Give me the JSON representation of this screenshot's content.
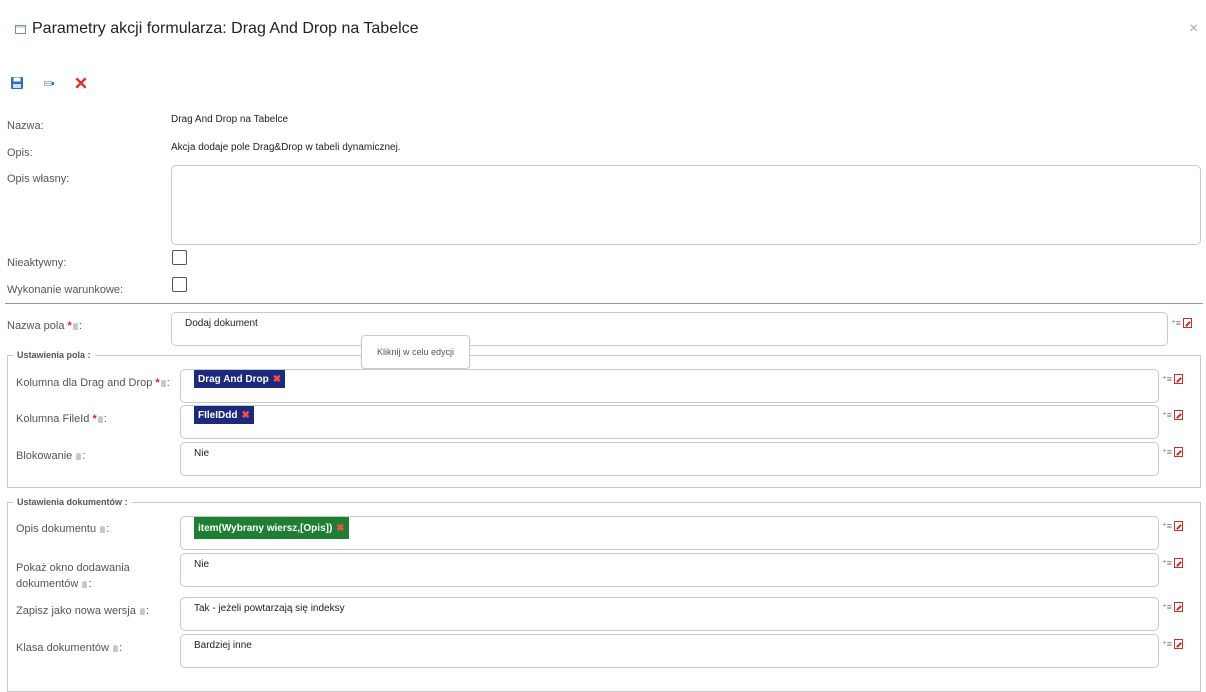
{
  "window": {
    "title": "Parametry akcji formularza: Drag And Drop na Tabelce",
    "close_glyph": "×"
  },
  "toolbar": {
    "save_icon": "save-icon",
    "export_icon": "export-icon",
    "delete_icon": "delete-icon"
  },
  "general": {
    "name_label": "Nazwa:",
    "name_value": "Drag And Drop na Tabelce",
    "desc_label": "Opis:",
    "desc_value": "Akcja dodaje pole Drag&Drop w tabeli dynamicznej.",
    "own_desc_label": "Opis własny:",
    "own_desc_value": "",
    "inactive_label": "Nieaktywny:",
    "conditional_label": "Wykonanie warunkowe:"
  },
  "field_name": {
    "label": "Nazwa pola",
    "value": "Dodaj dokument",
    "tooltip": "Kliknij w celu edycji"
  },
  "field_settings": {
    "legend": "Ustawienia pola :",
    "drag_col_label": "Kolumna dla Drag and Drop",
    "drag_col_tag": "Drag And Drop",
    "fileid_label": "Kolumna FileId",
    "fileid_tag": "FIleIDdd",
    "blocking_label": "Blokowanie",
    "blocking_value": "Nie"
  },
  "doc_settings": {
    "legend": "Ustawienia dokumentów :",
    "doc_desc_label": "Opis dokumentu",
    "doc_desc_tag": "item(Wybrany wiersz,[Opis])",
    "show_window_label_1": "Pokaż okno dodawania",
    "show_window_label_2": "dokumentów",
    "show_window_value": "Nie",
    "new_version_label": "Zapisz jako nowa wersja",
    "new_version_value": "Tak - jeżeli powtarzają się indeksy",
    "doc_class_label": "Klasa dokumentów",
    "doc_class_value": "Bardziej inne"
  },
  "common": {
    "required_mark": "*",
    "colon": ":",
    "tag_remove": "✖"
  },
  "colors": {
    "tag_blue": "#1b2a7d",
    "tag_green": "#1e7f33",
    "delete_red": "#e03030",
    "save_blue": "#2a6fb5"
  }
}
